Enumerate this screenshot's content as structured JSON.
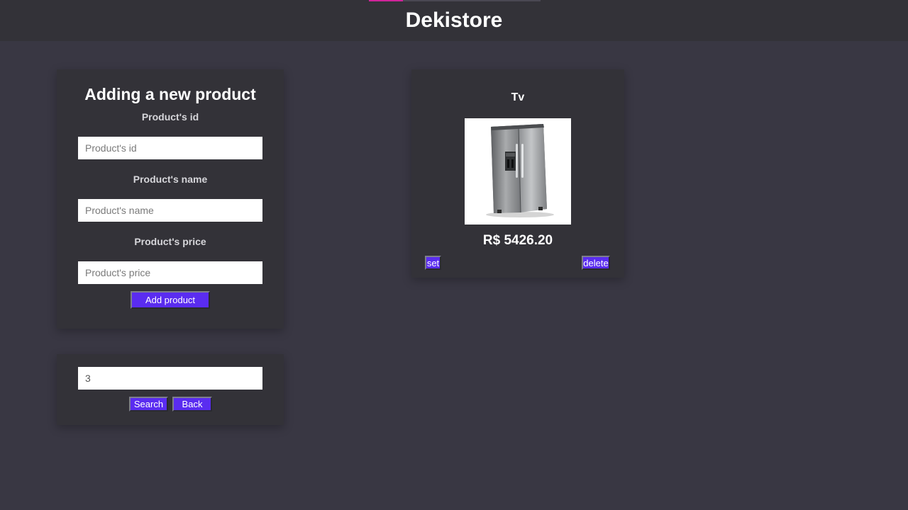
{
  "header": {
    "title": "Dekistore",
    "progress_fraction": 0.2
  },
  "form": {
    "heading": "Adding a new product",
    "id_label": "Product's id",
    "id_placeholder": "Product's id",
    "name_label": "Product's name",
    "name_placeholder": "Product's name",
    "price_label": "Product's price",
    "price_placeholder": "Product's price",
    "add_button": "Add product"
  },
  "search": {
    "value": "3",
    "search_button": "Search",
    "back_button": "Back"
  },
  "product": {
    "name": "Tv",
    "price": "R$ 5426.20",
    "set_button": "set",
    "delete_button": "delete",
    "image_icon": "refrigerator-icon"
  },
  "colors": {
    "background": "#393743",
    "card": "#333238",
    "button": "#5a2cf0",
    "progress": "#d0239a"
  }
}
